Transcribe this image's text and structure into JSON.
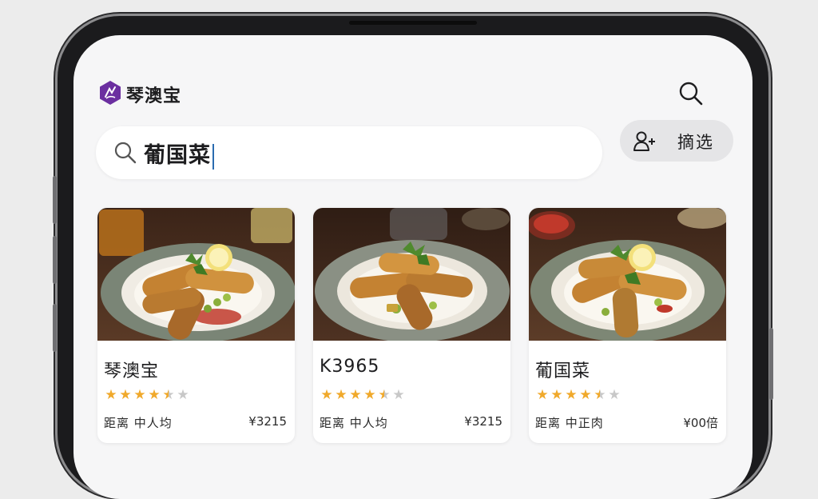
{
  "app": {
    "name": "琴澳宝",
    "logo_color": "#6b2fa0",
    "accent_color": "#2b6cb0"
  },
  "header": {
    "search_icon": "search-icon"
  },
  "search": {
    "query": "葡国菜",
    "icon": "search-icon"
  },
  "filter": {
    "label": "摘选",
    "icon": "user-add-icon"
  },
  "cards": [
    {
      "title": "琴澳宝",
      "rating": 4.5,
      "stars": [
        "★",
        "★",
        "★",
        "★",
        "★",
        "★"
      ],
      "meta": "距离 中人均",
      "price": "¥3215"
    },
    {
      "title": "K3965",
      "rating": 4.5,
      "stars": [
        "★",
        "★",
        "★",
        "★",
        "★",
        "★"
      ],
      "meta": "距离 中人均",
      "price": "¥3215"
    },
    {
      "title": "葡国菜",
      "rating": 4.5,
      "stars": [
        "★",
        "★",
        "★",
        "★",
        "★",
        "★"
      ],
      "meta": "距离 中正肉",
      "price": "¥00倍"
    }
  ],
  "colors": {
    "star_filled": "#f0a92b",
    "star_empty": "#c8c8c8"
  }
}
